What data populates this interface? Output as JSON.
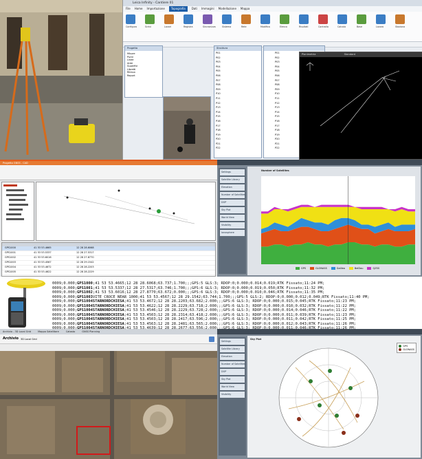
{
  "software_window": {
    "title": "Leica Infinity - Cantiere 01",
    "menu": [
      "File",
      "Home",
      "Importazione",
      "Topografia",
      "Dati",
      "Immagini",
      "Modellazione",
      "Mappa"
    ],
    "active_menu": "Topografia",
    "ribbon_buttons": [
      "Configura",
      "Scrivi",
      "Lavori",
      "Registra",
      "Sincronizza",
      "Sistema",
      "Rete",
      "Modifica",
      "Elenco",
      "Risultati",
      "Controlla",
      "Calcola",
      "Base",
      "Lavoro",
      "Staziona"
    ],
    "tree_panel_title": "Progetto",
    "tree_items": [
      "Misure",
      "Punti",
      "Linee",
      "Aree",
      "Superfici",
      "Libretti",
      "Rilievo",
      "Report"
    ],
    "points_panel_title": "Struttura",
    "points_rows": [
      "P01",
      "P02",
      "P03",
      "P04",
      "P05",
      "P06",
      "P07",
      "P08",
      "P09",
      "P10",
      "P11",
      "P12",
      "P13",
      "P14",
      "P15",
      "P16",
      "P17",
      "P18",
      "P19",
      "P20",
      "P21",
      "P22"
    ],
    "view_panel_title": "Planimetria",
    "view_mode": "Standard"
  },
  "cad_window": {
    "title": "Progetto GNSS - CAD",
    "table_rows": [
      [
        "GPS1000",
        "41 53 53.4665",
        "12 28 28.6068"
      ],
      [
        "GPS1001",
        "41 53 53.5337",
        "12 28 27.5317"
      ],
      [
        "GPS1002",
        "41 53 53.6016",
        "12 28 27.8770"
      ],
      [
        "GPS1003",
        "41 53 53.4567",
        "12 28 29.1542"
      ],
      [
        "GPS1004",
        "41 53 53.4672",
        "12 28 28.2203"
      ],
      [
        "GPS1005",
        "41 53 53.4622",
        "12 28 28.2229"
      ]
    ]
  },
  "planning_top": {
    "app_title": "GNSS Planning Online",
    "chart_title": "Number of Satellites",
    "sidebar": [
      "Settings",
      "Satellite Library",
      "Elevation",
      "Number of Satellites",
      "DOP",
      "Sky Plot",
      "World View",
      "Visibility",
      "Ionosphere"
    ],
    "legend": [
      "GPS",
      "GLONASS",
      "Galileo",
      "BeiDou",
      "QZSS"
    ]
  },
  "chart_data": {
    "type": "area",
    "title": "Number of Satellites",
    "series": [
      {
        "name": "GPS",
        "color": "#3faf3f",
        "values": [
          8,
          8,
          9,
          9,
          8,
          9,
          9,
          10,
          9,
          9,
          8,
          9,
          9,
          10,
          10,
          9,
          9,
          8,
          9,
          9,
          8,
          8,
          9,
          9
        ]
      },
      {
        "name": "GLONASS",
        "color": "#e05018",
        "values": [
          6,
          7,
          7,
          6,
          7,
          7,
          8,
          7,
          7,
          6,
          7,
          7,
          8,
          8,
          7,
          7,
          7,
          6,
          6,
          7,
          7,
          7,
          6,
          7
        ]
      },
      {
        "name": "Galileo",
        "color": "#2f8fd8",
        "values": [
          2,
          2,
          3,
          3,
          2,
          3,
          4,
          3,
          3,
          4,
          3,
          4,
          4,
          3,
          3,
          2,
          2,
          3,
          3,
          3,
          2,
          3,
          3,
          2
        ]
      },
      {
        "name": "BeiDou",
        "color": "#f0e014",
        "values": [
          7,
          6,
          6,
          7,
          7,
          6,
          5,
          6,
          7,
          7,
          8,
          6,
          5,
          5,
          6,
          7,
          7,
          8,
          7,
          6,
          7,
          7,
          6,
          6
        ]
      },
      {
        "name": "QZSS",
        "color": "#c833c8",
        "values": [
          1,
          1,
          1,
          0,
          1,
          1,
          1,
          1,
          0,
          1,
          1,
          1,
          1,
          1,
          0,
          1,
          1,
          1,
          1,
          0,
          1,
          1,
          1,
          1
        ]
      }
    ],
    "ylim": [
      0,
      40
    ]
  },
  "log": {
    "lines": [
      {
        "pre": "0009;0.000;",
        "bold": "GPS1000",
        "post": ";41 53 53.4665;12 28 28.6068;63.737;1.700;;;GPS:5 GLS:3; RDOP:0;0.000;0.014;0.019;RTK Fissato;11:24 PM;"
      },
      {
        "pre": "0009;0.000;",
        "bold": "GPS1001",
        "post": ";41 53 53.5337;12 28 27.5317;63.746;1.700;;;GPS:6 GLS:3; RDOP:0;0.000;0.019;0.050;RTK Fissato;11:32 PM;"
      },
      {
        "pre": "0009;0.000;",
        "bold": "GPS1002",
        "post": ";41 53 53.6016;12 28 27.8770;63.672;0.000;;;GPS:6 GLS:3; RDOP:0;0.000;0.010;0.046;RTK Fissato;11:35 PM;"
      },
      {
        "pre": "0009;0.000;",
        "bold": "GPS1003",
        "post": "VITE CROCE NEAR 1000;41 53 53.4567;12 28 29.1542;63.744;1.700;;;GPS:5 GLS:2; RDOP:0;0.000;0.012;0.049;RTK Fissato;11:40 PM;"
      },
      {
        "pre": "0009;0.000;",
        "bold": "GPS1004STARNORDCHIESA",
        "post": ";41 53 53.4672;12 28 28.2203;63.682;2.000;;;GPS:6 GLS:3; RDOP:0;0.000;0.015;0.045;RTK Fissato;11:23 PM;"
      },
      {
        "pre": "0009;0.000;",
        "bold": "GPS1004STARNORDCHIESA",
        "post": ";41 53 53.4622;12 28 28.2229;63.718;2.000;;;GPS:6 GLS:3; RDOP:0;0.000;0.010;0.032;RTK Fissato;11:22 PM;"
      },
      {
        "pre": "0009;0.000;",
        "bold": "GPS1004STARNORDCHIESA",
        "post": ";41 53 53.4546;12 28 28.2229;63.728;2.000;;;GPS:6 GLS:3; RDOP:0;0.000;0.014;0.046;RTK Fissato;11:22 PM;"
      },
      {
        "pre": "0009;0.000;",
        "bold": "GPS1004STARNORDCHIESA",
        "post": ";41 53 53.4503;12 28 28.2314;63.418;2.000;;;GPS:6 GLS:3; RDOP:0;0.000;0.011;0.039;RTK Fissato;11:23 PM;"
      },
      {
        "pre": "0009;0.000;",
        "bold": "GPS1004STARNORDCHIESA",
        "post": ";41 53 53.4503;12 28 28.2417;63.596;2.000;;;GPS:6 GLS:3; RDOP:0;0.000;0.011;0.042;RTK Fissato;11:25 PM;"
      },
      {
        "pre": "0009;0.000;",
        "bold": "GPS1004STARNORDCHIESA",
        "post": ";41 53 53.4563;12 28 28.2481;63.565;2.000;;;GPS:6 GLS:3; RDOP:0;0.000;0.012;0.043;RTK Fissato;11:26 PM;"
      },
      {
        "pre": "0009;0.000;",
        "bold": "GPS1004STARNORDCHIESA",
        "post": ";41 53 53.4639;12 28 28.2677;63.556;2.000;;;GPS:6 GLS:3; RDOP:0;0.000;0.011;0.046;RTK Fissato;11:26 PM;"
      },
      {
        "pre": "0009;0.000;",
        "bold": "GPS1004STARNORDCHIESA",
        "post": ";41 53 53.4684;12 28 28.2606;63.562;2.000;;;GPS:6 GLS:3; RDOP:0;0.000;0.009;0.033;RTK Fissato;11:26 PM;"
      },
      {
        "pre": "0009;0.000;",
        "bold": "GPS1004STARNORDCHIESA",
        "post": ";41 53 53.4684;12 28 28.2607;63.562;2.000;;;GPS:6 GLS:3; RDOP:0;0.000;0.010;0.037;RTK Fissato;11:26 PM;"
      }
    ]
  },
  "map_window": {
    "browser_tabs": [
      "Archivio - 3D Local Grid",
      "Mappa Satellitare",
      "Catasto",
      "GNSS Planning"
    ],
    "toolbar_title": "Archivio",
    "toolbar_search": "3D Local Grid"
  },
  "planning_bottom": {
    "app_title": "GNSS Planning Online",
    "chart_title": "Sky Plot",
    "sidebar": [
      "Settings",
      "Satellite Library",
      "Elevation",
      "Number of Satellites",
      "DOP",
      "Sky Plot",
      "World View",
      "Visibility"
    ],
    "legend": [
      "GPS",
      "GLONASS"
    ]
  },
  "colors": {
    "orange_accent": "#e35b1c",
    "planning_bg": "#7f8a96",
    "ribbon_blue": "#1d5ea8"
  }
}
